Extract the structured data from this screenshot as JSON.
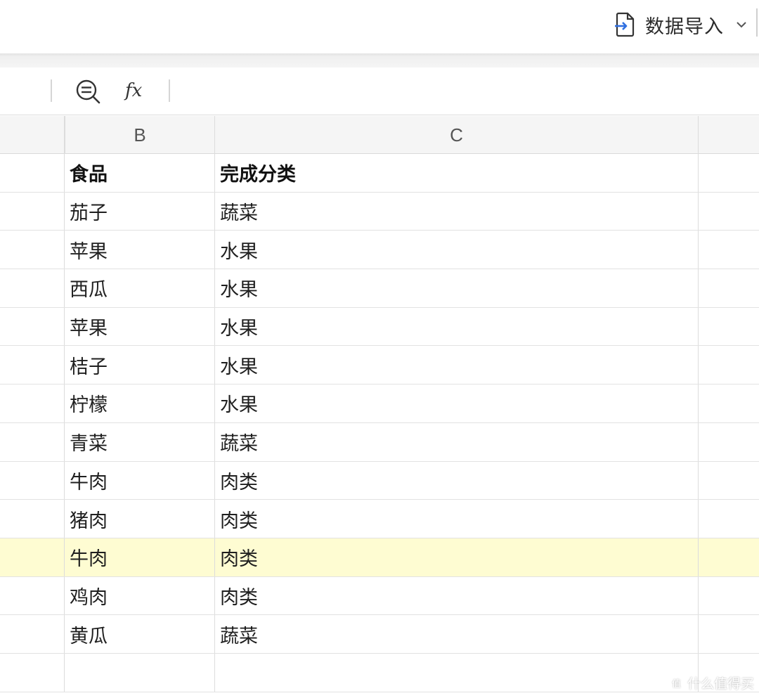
{
  "toolbar": {
    "import_label": "数据导入",
    "import_icon": "file-import-icon",
    "chevron_icon": "chevron-down-icon"
  },
  "formula_bar": {
    "zoom_icon": "zoom-out-icon",
    "fx_label": "fx"
  },
  "columns": [
    "",
    "B",
    "C",
    ""
  ],
  "rows": [
    {
      "b": "食品",
      "c": "完成分类",
      "header": true
    },
    {
      "b": "茄子",
      "c": "蔬菜"
    },
    {
      "b": "苹果",
      "c": "水果"
    },
    {
      "b": "西瓜",
      "c": "水果"
    },
    {
      "b": "苹果",
      "c": "水果"
    },
    {
      "b": "桔子",
      "c": "水果"
    },
    {
      "b": "柠檬",
      "c": "水果"
    },
    {
      "b": "青菜",
      "c": "蔬菜"
    },
    {
      "b": "牛肉",
      "c": "肉类"
    },
    {
      "b": "猪肉",
      "c": "肉类"
    },
    {
      "b": "牛肉",
      "c": "肉类",
      "highlight": true
    },
    {
      "b": "鸡肉",
      "c": "肉类"
    },
    {
      "b": "黄瓜",
      "c": "蔬菜"
    },
    {
      "b": "",
      "c": ""
    }
  ],
  "colors": {
    "highlight_row": "#fefcd2",
    "header_bg": "#f5f5f5",
    "icon_blue": "#2f6fe0"
  },
  "watermark": {
    "text": "什么值得买"
  }
}
